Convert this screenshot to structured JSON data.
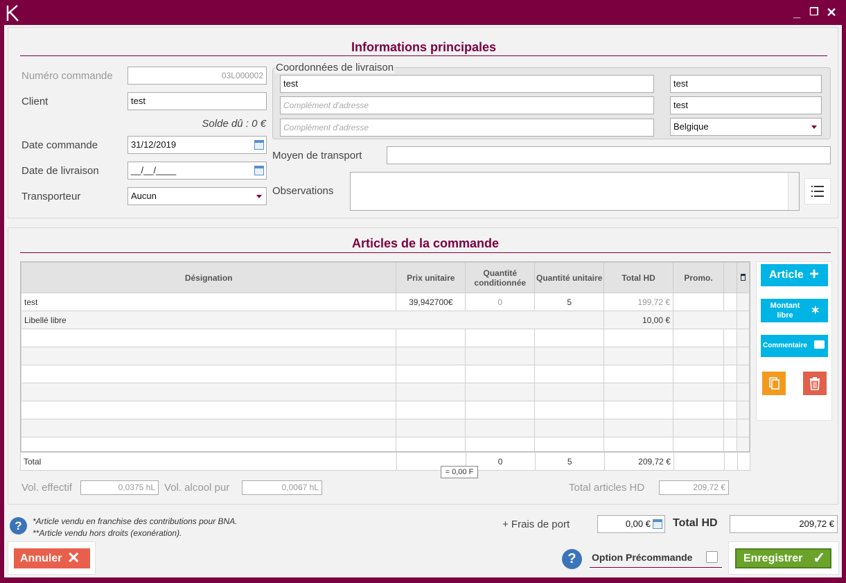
{
  "window": {
    "logo": "K",
    "minimize_glyph": "_",
    "restore_glyph": "❐",
    "close_glyph": "✕"
  },
  "main_info": {
    "title": "Informations principales",
    "numero_label": "Numéro commande",
    "numero_value": "03L000002",
    "client_label": "Client",
    "client_value": "test",
    "solde": "Solde dû : 0 €",
    "date_commande_label": "Date commande",
    "date_commande_value": "31/12/2019",
    "date_livraison_label": "Date de livraison",
    "date_livraison_value": "__/__/____",
    "transporteur_label": "Transporteur",
    "transporteur_value": "Aucun",
    "livraison": {
      "legend": "Coordonnées de livraison",
      "address1": "test",
      "complement1_placeholder": "Complément d'adresse",
      "complement2_placeholder": "Complément d'adresse",
      "postal": "test",
      "city": "test",
      "country": "Belgique"
    },
    "transport_label": "Moyen de transport",
    "transport_value": "",
    "observations_label": "Observations",
    "observations_value": ""
  },
  "articles": {
    "title": "Articles de la commande",
    "columns": [
      "Désignation",
      "Prix unitaire",
      "Quantité conditionnée",
      "Quantité unitaire",
      "Total HD",
      "Promo."
    ],
    "rows": [
      {
        "designation": "test",
        "prix": "39,942700€",
        "qte_cond": "0",
        "qte_unit": "5",
        "total": "199,72 €",
        "promo": ""
      },
      {
        "designation": "Libellé libre",
        "total": "10,00 €"
      }
    ],
    "total_row": {
      "label": "Total",
      "qte_cond": "0",
      "qte_unit": "5",
      "total": "209,72 €"
    },
    "tooltip": "= 0,00 F",
    "vol_effectif_label": "Vol. effectif",
    "vol_effectif_value": "0,0375 hL",
    "vol_alcool_label": "Vol. alcool pur",
    "vol_alcool_value": "0,0067 hL",
    "total_articles_label": "Total articles HD",
    "total_articles_value": "209,72 €",
    "buttons": {
      "article": "Article",
      "montant_libre": "Montant libre",
      "commentaire": "Commentaire"
    }
  },
  "footer": {
    "note1": "*Article vendu en franchise des contributions pour BNA.",
    "note2": "**Article vendu hors droits (exonération).",
    "frais_label": "+ Frais de port",
    "frais_value": "0,00 €",
    "total_hd_label": "Total HD",
    "total_hd_value": "209,72 €",
    "annuler": "Annuler",
    "option_precommande": "Option Précommande",
    "enregistrer": "Enregistrer"
  },
  "colors": {
    "brand": "#7a0040",
    "accent_blue": "#00b4e6",
    "cancel_red": "#e8604c",
    "save_green": "#6aa32a",
    "copy_orange": "#f39a1e"
  }
}
